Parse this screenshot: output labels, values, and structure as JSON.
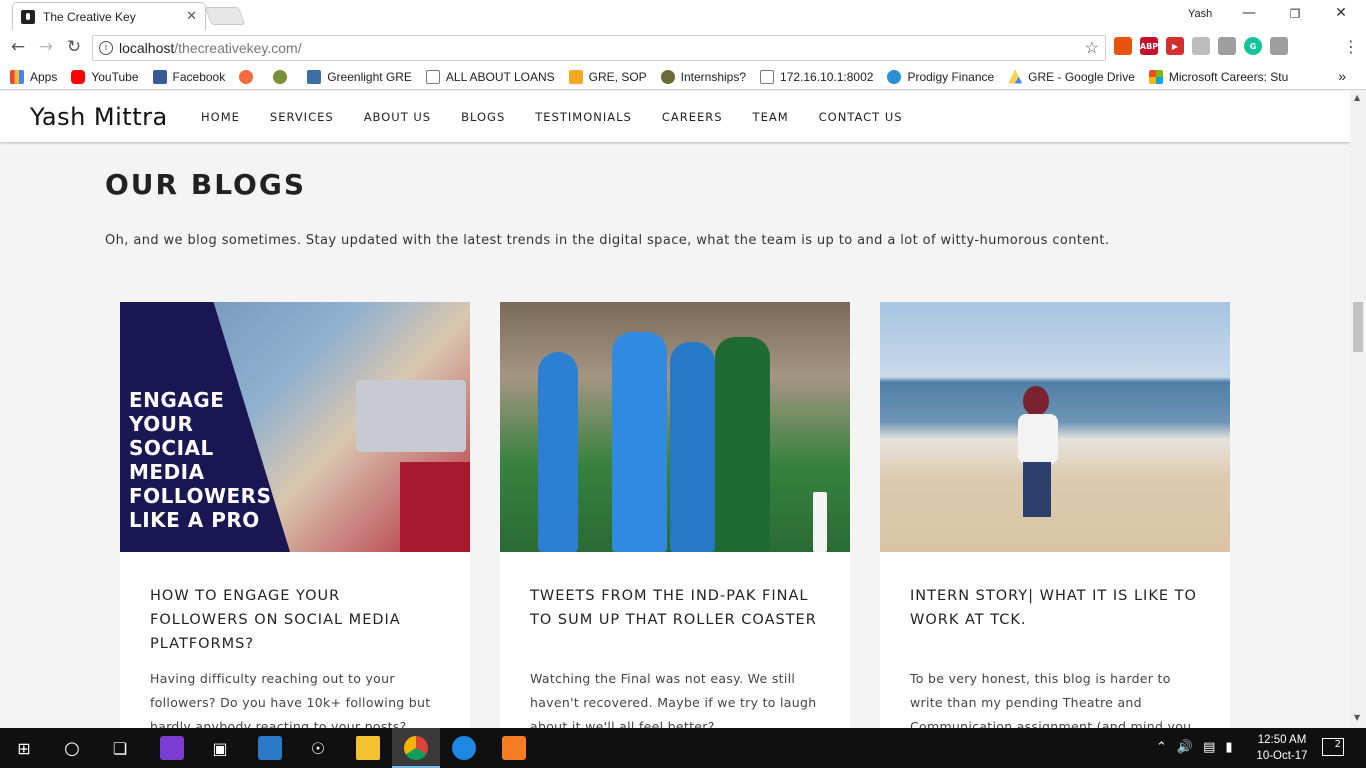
{
  "browser": {
    "tab_title": "The Creative Key",
    "tab_close": "✕",
    "user_name": "Yash",
    "url_host": "localhost",
    "url_path": "/thecreativekey.com/",
    "bookmarks": [
      {
        "label": "Apps",
        "color": "#e8453c"
      },
      {
        "label": "YouTube",
        "color": "#ff0000"
      },
      {
        "label": "Facebook",
        "color": "#3b5998"
      },
      {
        "label": "",
        "color": "#f36b3f"
      },
      {
        "label": "",
        "color": "#7a8d3b"
      },
      {
        "label": "Greenlight GRE",
        "color": "#3a6ea5"
      },
      {
        "label": "ALL ABOUT LOANS",
        "color": "#999999"
      },
      {
        "label": "GRE, SOP",
        "color": "#f5a623"
      },
      {
        "label": "Internships?",
        "color": "#6b6b3a"
      },
      {
        "label": "172.16.10.1:8002",
        "color": "#999999"
      },
      {
        "label": "Prodigy Finance",
        "color": "#2b8fd6"
      },
      {
        "label": "GRE - Google Drive",
        "color": "#1fa463"
      },
      {
        "label": "Microsoft Careers: Stu",
        "color": "#f25022"
      }
    ],
    "bookmarks_more": "»"
  },
  "site": {
    "brand": "Yash Mittra",
    "nav": [
      "HOME",
      "SERVICES",
      "ABOUT US",
      "BLOGS",
      "TESTIMONIALS",
      "CAREERS",
      "TEAM",
      "CONTACT US"
    ],
    "section_title": "OUR BLOGS",
    "section_subtitle": "Oh, and we blog sometimes. Stay updated with the latest trends in the digital space, what the team is up to and a lot of witty-humorous content.",
    "cards": [
      {
        "image_text": [
          "ENGAGE",
          "YOUR",
          "SOCIAL",
          "MEDIA",
          "FOLLOWERS",
          "LIKE A PRO"
        ],
        "title": "HOW TO ENGAGE YOUR FOLLOWERS ON SOCIAL MEDIA PLATFORMS?",
        "excerpt": "Having difficulty reaching out to your followers? Do you have 10k+ following but hardly anybody reacting to your posts? Learn"
      },
      {
        "title": "TWEETS FROM THE IND-PAK FINAL TO SUM UP THAT ROLLER COASTER",
        "excerpt": "Watching the Final was not easy. We still haven't recovered. Maybe if we try to laugh about it we'll all feel better?"
      },
      {
        "title": "INTERN STORY| WHAT IT IS LIKE TO WORK AT TCK.",
        "excerpt": "To be very honest, this blog is harder to write than my pending Theatre and Communication assignment (and mind you, the Theatre and"
      }
    ]
  },
  "taskbar": {
    "time": "12:50 AM",
    "date": "10-Oct-17",
    "notification_count": "2"
  }
}
